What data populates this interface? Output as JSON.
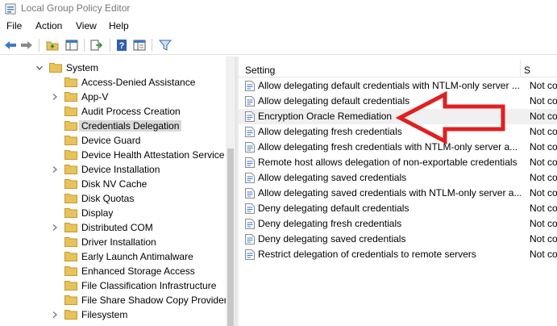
{
  "window": {
    "title": "Local Group Policy Editor"
  },
  "menu": [
    "File",
    "Action",
    "View",
    "Help"
  ],
  "toolbar": {
    "buttons": [
      "back-icon",
      "forward-icon",
      "up-folder-icon",
      "show-hide-tree-icon",
      "export-list-icon",
      "help-icon",
      "properties-icon",
      "filter-icon"
    ]
  },
  "tree": {
    "root_label": "System",
    "items": [
      {
        "label": "Access-Denied Assistance",
        "expandable": false
      },
      {
        "label": "App-V",
        "expandable": true
      },
      {
        "label": "Audit Process Creation",
        "expandable": false
      },
      {
        "label": "Credentials Delegation",
        "expandable": false,
        "selected": true
      },
      {
        "label": "Device Guard",
        "expandable": false
      },
      {
        "label": "Device Health Attestation Service",
        "expandable": false
      },
      {
        "label": "Device Installation",
        "expandable": true
      },
      {
        "label": "Disk NV Cache",
        "expandable": false
      },
      {
        "label": "Disk Quotas",
        "expandable": false
      },
      {
        "label": "Display",
        "expandable": false
      },
      {
        "label": "Distributed COM",
        "expandable": true
      },
      {
        "label": "Driver Installation",
        "expandable": false
      },
      {
        "label": "Early Launch Antimalware",
        "expandable": false
      },
      {
        "label": "Enhanced Storage Access",
        "expandable": false
      },
      {
        "label": "File Classification Infrastructure",
        "expandable": false
      },
      {
        "label": "File Share Shadow Copy Provider",
        "expandable": false
      },
      {
        "label": "Filesystem",
        "expandable": true
      }
    ]
  },
  "list": {
    "columns": {
      "setting": "Setting",
      "state": "S"
    },
    "rows": [
      {
        "setting": "Allow delegating default credentials with NTLM-only server ...",
        "state": "Not co"
      },
      {
        "setting": "Allow delegating default credentials",
        "state": "Not co"
      },
      {
        "setting": "Encryption Oracle Remediation",
        "state": "Not co",
        "highlight": true
      },
      {
        "setting": "Allow delegating fresh credentials",
        "state": "Not co"
      },
      {
        "setting": "Allow delegating fresh credentials with NTLM-only server a...",
        "state": "Not co"
      },
      {
        "setting": "Remote host allows delegation of non-exportable credentials",
        "state": "Not co"
      },
      {
        "setting": "Allow delegating saved credentials",
        "state": "Not co"
      },
      {
        "setting": "Allow delegating saved credentials with NTLM-only server a...",
        "state": "Not co"
      },
      {
        "setting": "Deny delegating default credentials",
        "state": "Not co"
      },
      {
        "setting": "Deny delegating fresh credentials",
        "state": "Not co"
      },
      {
        "setting": "Deny delegating saved credentials",
        "state": "Not co"
      },
      {
        "setting": "Restrict delegation of credentials to remote servers",
        "state": "Not co"
      }
    ]
  },
  "annotation": {
    "color": "#e02020"
  },
  "colors": {
    "folder": "#e8c25a",
    "accent": "#3b78c9",
    "selection": "#d9d9d9"
  }
}
